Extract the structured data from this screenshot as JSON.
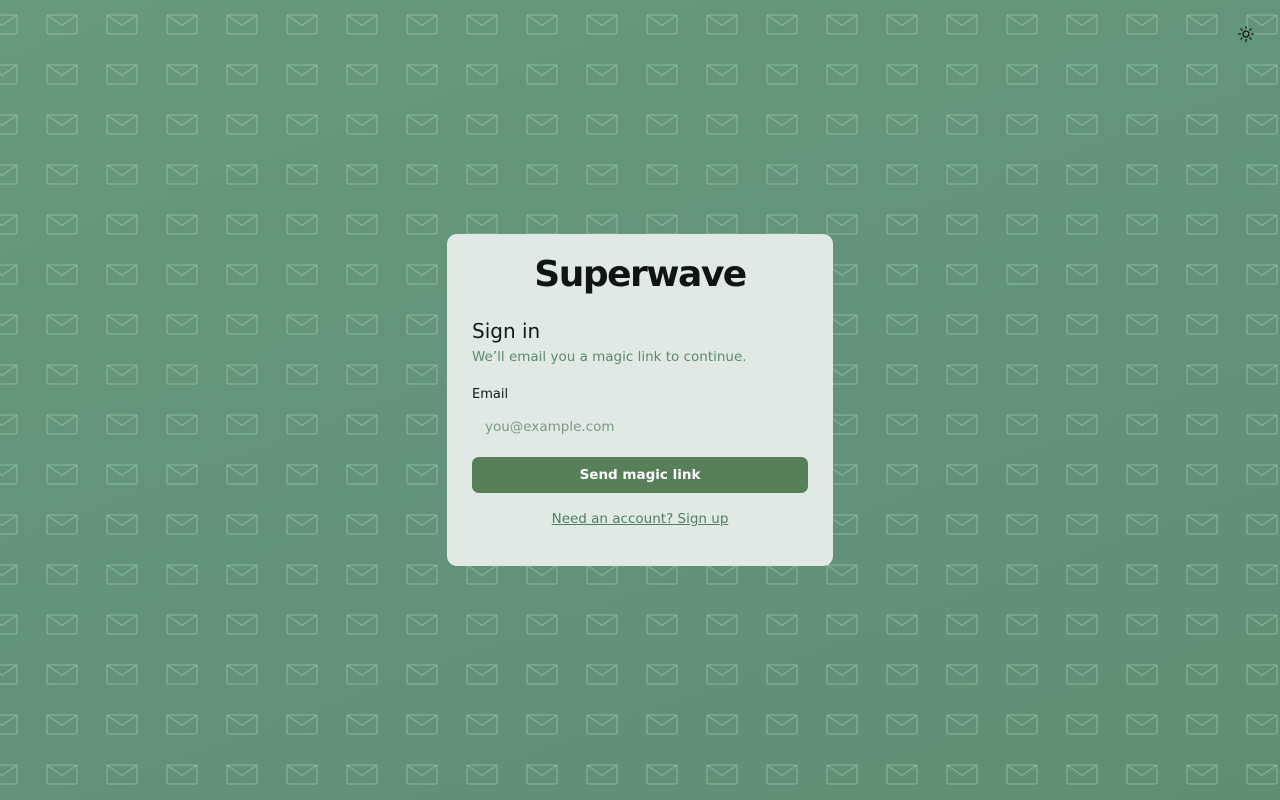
{
  "app": {
    "brand": "Superwave"
  },
  "theme_toggle": {
    "icon": "sun-icon"
  },
  "background": {
    "pattern_icon": "envelope-icon"
  },
  "signin": {
    "title": "Sign in",
    "subtitle": "We’ll email you a magic link to continue.",
    "email_label": "Email",
    "email_placeholder": "you@example.com",
    "email_value": "",
    "submit_label": "Send magic link",
    "signup_link": "Need an account? Sign up"
  },
  "colors": {
    "background": "#669a7a",
    "card": "#e1e9e4",
    "primary_button": "#577f59",
    "accent_text": "#5c8a6c"
  }
}
